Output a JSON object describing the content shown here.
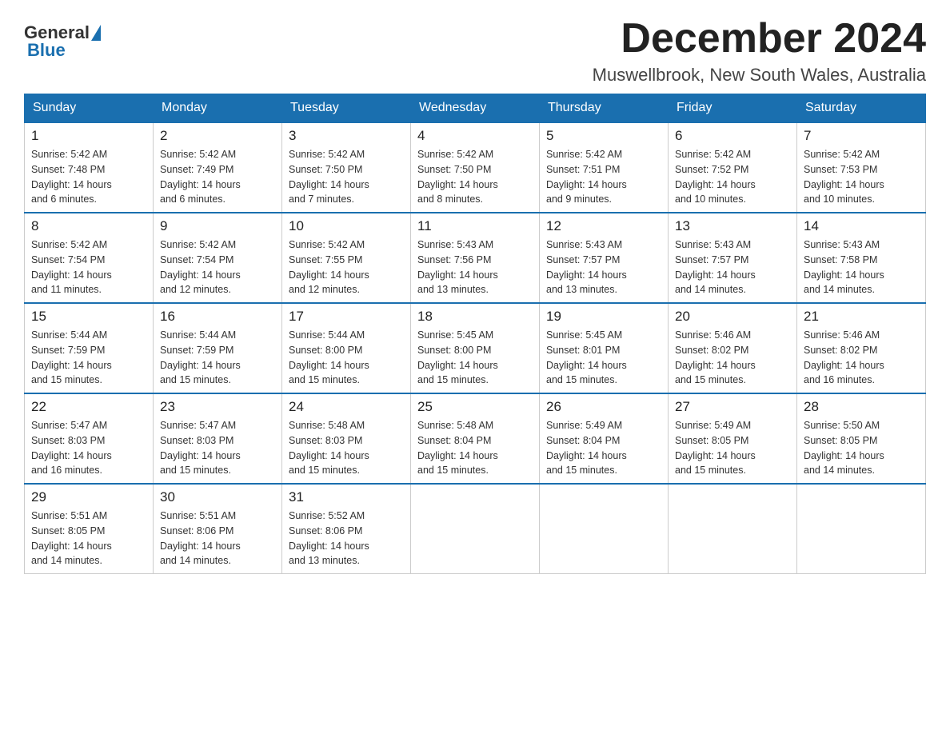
{
  "header": {
    "logo_general": "General",
    "logo_blue": "Blue",
    "month_title": "December 2024",
    "location": "Muswellbrook, New South Wales, Australia"
  },
  "days_of_week": [
    "Sunday",
    "Monday",
    "Tuesday",
    "Wednesday",
    "Thursday",
    "Friday",
    "Saturday"
  ],
  "weeks": [
    [
      {
        "day": "1",
        "sunrise": "5:42 AM",
        "sunset": "7:48 PM",
        "daylight": "14 hours and 6 minutes."
      },
      {
        "day": "2",
        "sunrise": "5:42 AM",
        "sunset": "7:49 PM",
        "daylight": "14 hours and 6 minutes."
      },
      {
        "day": "3",
        "sunrise": "5:42 AM",
        "sunset": "7:50 PM",
        "daylight": "14 hours and 7 minutes."
      },
      {
        "day": "4",
        "sunrise": "5:42 AM",
        "sunset": "7:50 PM",
        "daylight": "14 hours and 8 minutes."
      },
      {
        "day": "5",
        "sunrise": "5:42 AM",
        "sunset": "7:51 PM",
        "daylight": "14 hours and 9 minutes."
      },
      {
        "day": "6",
        "sunrise": "5:42 AM",
        "sunset": "7:52 PM",
        "daylight": "14 hours and 10 minutes."
      },
      {
        "day": "7",
        "sunrise": "5:42 AM",
        "sunset": "7:53 PM",
        "daylight": "14 hours and 10 minutes."
      }
    ],
    [
      {
        "day": "8",
        "sunrise": "5:42 AM",
        "sunset": "7:54 PM",
        "daylight": "14 hours and 11 minutes."
      },
      {
        "day": "9",
        "sunrise": "5:42 AM",
        "sunset": "7:54 PM",
        "daylight": "14 hours and 12 minutes."
      },
      {
        "day": "10",
        "sunrise": "5:42 AM",
        "sunset": "7:55 PM",
        "daylight": "14 hours and 12 minutes."
      },
      {
        "day": "11",
        "sunrise": "5:43 AM",
        "sunset": "7:56 PM",
        "daylight": "14 hours and 13 minutes."
      },
      {
        "day": "12",
        "sunrise": "5:43 AM",
        "sunset": "7:57 PM",
        "daylight": "14 hours and 13 minutes."
      },
      {
        "day": "13",
        "sunrise": "5:43 AM",
        "sunset": "7:57 PM",
        "daylight": "14 hours and 14 minutes."
      },
      {
        "day": "14",
        "sunrise": "5:43 AM",
        "sunset": "7:58 PM",
        "daylight": "14 hours and 14 minutes."
      }
    ],
    [
      {
        "day": "15",
        "sunrise": "5:44 AM",
        "sunset": "7:59 PM",
        "daylight": "14 hours and 15 minutes."
      },
      {
        "day": "16",
        "sunrise": "5:44 AM",
        "sunset": "7:59 PM",
        "daylight": "14 hours and 15 minutes."
      },
      {
        "day": "17",
        "sunrise": "5:44 AM",
        "sunset": "8:00 PM",
        "daylight": "14 hours and 15 minutes."
      },
      {
        "day": "18",
        "sunrise": "5:45 AM",
        "sunset": "8:00 PM",
        "daylight": "14 hours and 15 minutes."
      },
      {
        "day": "19",
        "sunrise": "5:45 AM",
        "sunset": "8:01 PM",
        "daylight": "14 hours and 15 minutes."
      },
      {
        "day": "20",
        "sunrise": "5:46 AM",
        "sunset": "8:02 PM",
        "daylight": "14 hours and 15 minutes."
      },
      {
        "day": "21",
        "sunrise": "5:46 AM",
        "sunset": "8:02 PM",
        "daylight": "14 hours and 16 minutes."
      }
    ],
    [
      {
        "day": "22",
        "sunrise": "5:47 AM",
        "sunset": "8:03 PM",
        "daylight": "14 hours and 16 minutes."
      },
      {
        "day": "23",
        "sunrise": "5:47 AM",
        "sunset": "8:03 PM",
        "daylight": "14 hours and 15 minutes."
      },
      {
        "day": "24",
        "sunrise": "5:48 AM",
        "sunset": "8:03 PM",
        "daylight": "14 hours and 15 minutes."
      },
      {
        "day": "25",
        "sunrise": "5:48 AM",
        "sunset": "8:04 PM",
        "daylight": "14 hours and 15 minutes."
      },
      {
        "day": "26",
        "sunrise": "5:49 AM",
        "sunset": "8:04 PM",
        "daylight": "14 hours and 15 minutes."
      },
      {
        "day": "27",
        "sunrise": "5:49 AM",
        "sunset": "8:05 PM",
        "daylight": "14 hours and 15 minutes."
      },
      {
        "day": "28",
        "sunrise": "5:50 AM",
        "sunset": "8:05 PM",
        "daylight": "14 hours and 14 minutes."
      }
    ],
    [
      {
        "day": "29",
        "sunrise": "5:51 AM",
        "sunset": "8:05 PM",
        "daylight": "14 hours and 14 minutes."
      },
      {
        "day": "30",
        "sunrise": "5:51 AM",
        "sunset": "8:06 PM",
        "daylight": "14 hours and 14 minutes."
      },
      {
        "day": "31",
        "sunrise": "5:52 AM",
        "sunset": "8:06 PM",
        "daylight": "14 hours and 13 minutes."
      },
      null,
      null,
      null,
      null
    ]
  ],
  "labels": {
    "sunrise": "Sunrise:",
    "sunset": "Sunset:",
    "daylight": "Daylight:"
  }
}
